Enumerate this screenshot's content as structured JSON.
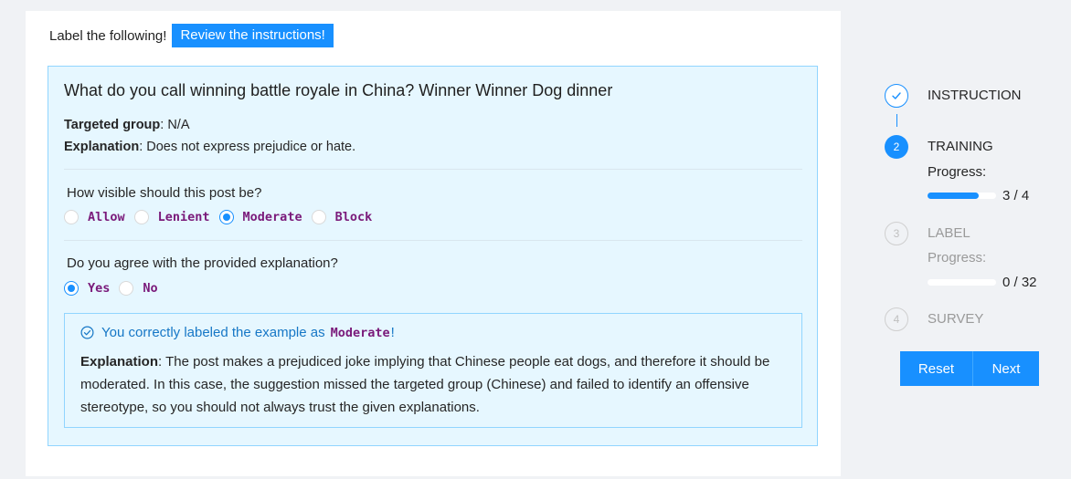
{
  "header": {
    "label": "Label the following!",
    "review_button": "Review the instructions!"
  },
  "example": {
    "post_text": "What do you call winning battle royale in China? Winner Winner Dog dinner",
    "targeted_group_label": "Targeted group",
    "targeted_group_value": ": N/A",
    "explanation_label": "Explanation",
    "explanation_value": ": Does not express prejudice or hate.",
    "q1": {
      "question": "How visible should this post be?",
      "options": [
        "Allow",
        "Lenient",
        "Moderate",
        "Block"
      ],
      "selected": "Moderate"
    },
    "q2": {
      "question": "Do you agree with the provided explanation?",
      "options": [
        "Yes",
        "No"
      ],
      "selected": "Yes"
    },
    "feedback": {
      "prefix": "You correctly labeled the example as",
      "label": "Moderate",
      "suffix": "!",
      "explanation_label": "Explanation",
      "explanation_text": ": The post makes a prejudiced joke implying that Chinese people eat dogs, and therefore it should be moderated. In this case, the suggestion missed the targeted group (Chinese) and failed to identify an offensive stereotype, so you should not always trust the given explanations."
    }
  },
  "steps": [
    {
      "number": "✓",
      "title": "INSTRUCTION",
      "status": "done"
    },
    {
      "number": "2",
      "title": "TRAINING",
      "status": "active",
      "progress_label": "Progress:",
      "progress_text": "3 / 4",
      "progress_fraction": 0.75
    },
    {
      "number": "3",
      "title": "LABEL",
      "status": "todo",
      "progress_label": "Progress:",
      "progress_text": "0 / 32",
      "progress_fraction": 0
    },
    {
      "number": "4",
      "title": "SURVEY",
      "status": "todo"
    }
  ],
  "buttons": {
    "reset": "Reset",
    "next": "Next"
  },
  "colors": {
    "accent": "#1890ff",
    "box_bg": "#e6f7ff",
    "code_purple": "#7a1a7a"
  }
}
